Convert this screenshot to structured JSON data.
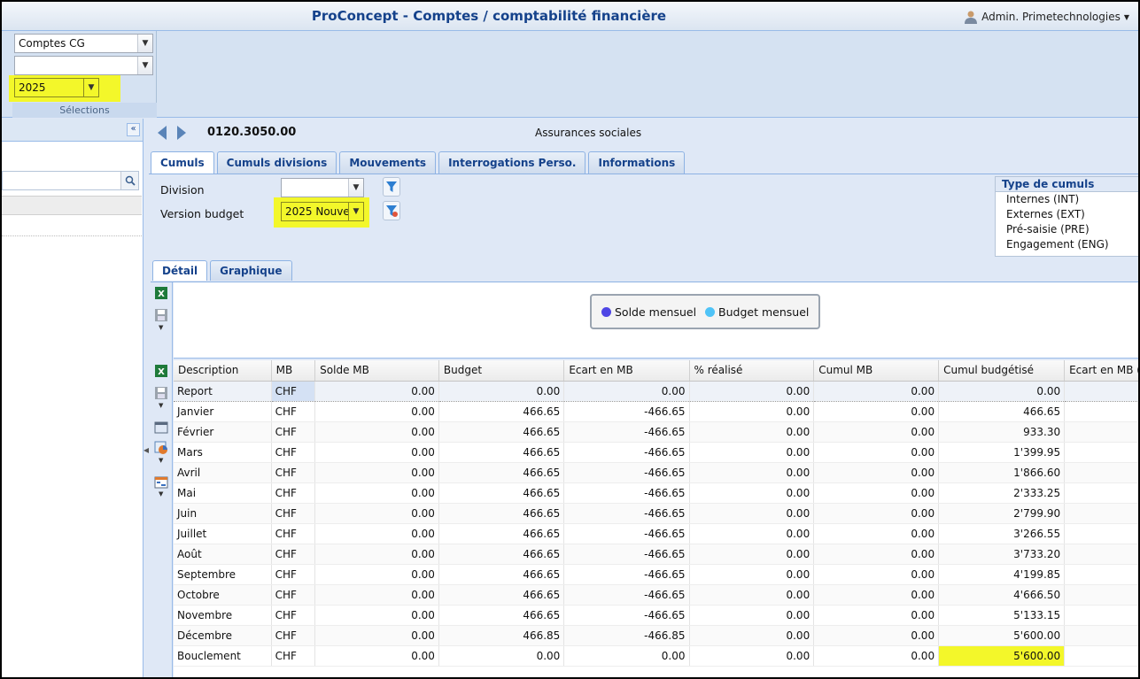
{
  "app": {
    "title": "ProConcept - Comptes / comptabilité financière",
    "user": "Admin. Primetechnologies"
  },
  "selections": {
    "combo1": "Comptes CG",
    "combo2": "",
    "year": "2025",
    "label": "Sélections"
  },
  "account": {
    "number": "0120.3050.00",
    "name": "Assurances sociales"
  },
  "tabs": [
    "Cumuls",
    "Cumuls divisions",
    "Mouvements",
    "Interrogations Perso.",
    "Informations"
  ],
  "filters": {
    "division_label": "Division",
    "division_value": "",
    "budget_label": "Version budget",
    "budget_value": "2025 Nouve"
  },
  "cumul_types": {
    "title": "Type de cumuls",
    "items": [
      "Internes (INT)",
      "Externes (EXT)",
      "Pré-saisie (PRE)",
      "Engagement (ENG)"
    ]
  },
  "subtabs": [
    "Détail",
    "Graphique"
  ],
  "legend": {
    "solde": "Solde mensuel",
    "budget": "Budget mensuel",
    "solde_color": "#4f46e5",
    "budget_color": "#4fc3f7"
  },
  "table": {
    "columns": [
      "Description",
      "MB",
      "Solde MB",
      "Budget",
      "Ecart en MB",
      "% réalisé",
      "Cumul MB",
      "Cumul budgétisé",
      "Ecart en MB ("
    ],
    "rows": [
      [
        "Report",
        "CHF",
        "0.00",
        "0.00",
        "0.00",
        "0.00",
        "0.00",
        "0.00"
      ],
      [
        "Janvier",
        "CHF",
        "0.00",
        "466.65",
        "-466.65",
        "0.00",
        "0.00",
        "466.65"
      ],
      [
        "Février",
        "CHF",
        "0.00",
        "466.65",
        "-466.65",
        "0.00",
        "0.00",
        "933.30"
      ],
      [
        "Mars",
        "CHF",
        "0.00",
        "466.65",
        "-466.65",
        "0.00",
        "0.00",
        "1'399.95"
      ],
      [
        "Avril",
        "CHF",
        "0.00",
        "466.65",
        "-466.65",
        "0.00",
        "0.00",
        "1'866.60"
      ],
      [
        "Mai",
        "CHF",
        "0.00",
        "466.65",
        "-466.65",
        "0.00",
        "0.00",
        "2'333.25"
      ],
      [
        "Juin",
        "CHF",
        "0.00",
        "466.65",
        "-466.65",
        "0.00",
        "0.00",
        "2'799.90"
      ],
      [
        "Juillet",
        "CHF",
        "0.00",
        "466.65",
        "-466.65",
        "0.00",
        "0.00",
        "3'266.55"
      ],
      [
        "Août",
        "CHF",
        "0.00",
        "466.65",
        "-466.65",
        "0.00",
        "0.00",
        "3'733.20"
      ],
      [
        "Septembre",
        "CHF",
        "0.00",
        "466.65",
        "-466.65",
        "0.00",
        "0.00",
        "4'199.85"
      ],
      [
        "Octobre",
        "CHF",
        "0.00",
        "466.65",
        "-466.65",
        "0.00",
        "0.00",
        "4'666.50"
      ],
      [
        "Novembre",
        "CHF",
        "0.00",
        "466.65",
        "-466.65",
        "0.00",
        "0.00",
        "5'133.15"
      ],
      [
        "Décembre",
        "CHF",
        "0.00",
        "466.85",
        "-466.85",
        "0.00",
        "0.00",
        "5'600.00"
      ],
      [
        "Bouclement",
        "CHF",
        "0.00",
        "0.00",
        "0.00",
        "0.00",
        "0.00",
        "5'600.00"
      ]
    ]
  },
  "colors": {
    "highlight": "#f3f72a",
    "header_blue": "#15428b"
  }
}
